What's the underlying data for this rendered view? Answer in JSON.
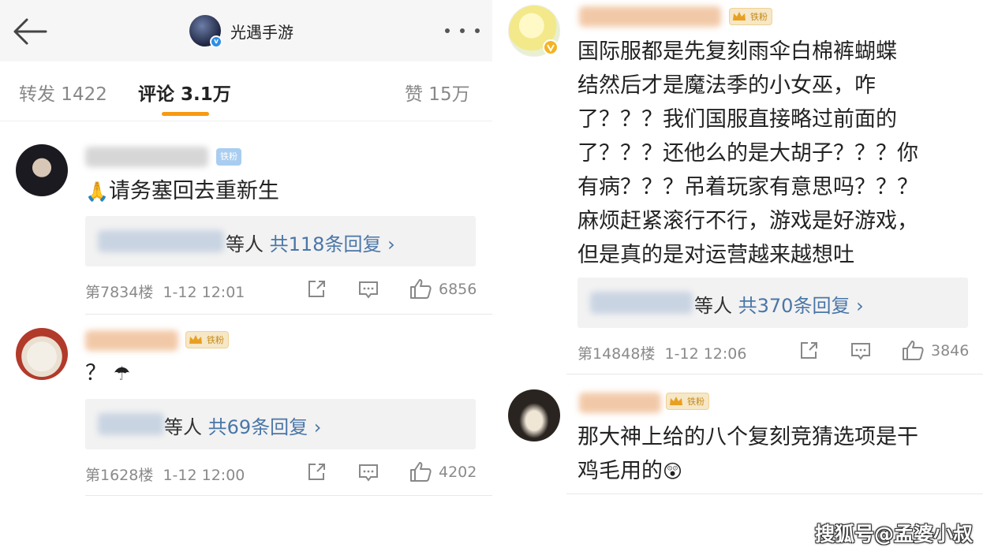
{
  "header": {
    "account_name": "光遇手游",
    "back_icon": "arrow-left-icon",
    "more_icon": "more-dots-icon",
    "verified_color": "#2e8ee8"
  },
  "tabs": {
    "repost": "转发 1422",
    "comments": "评论 3.1万",
    "likes": "赞 15万",
    "accent": "#f79a11"
  },
  "comments": [
    {
      "badge": "铁粉",
      "emoji": "pray-hands-icon",
      "text": "请务塞回去重新生",
      "reply_suffix": "等人",
      "reply_count": "共118条回复 ›",
      "floor": "第7834楼",
      "time": "1-12 12:01",
      "likes": "6856"
    },
    {
      "badge": "铁粉",
      "text": "？",
      "emoji": "umbrella-icon",
      "reply_suffix": "等人",
      "reply_count": "共69条回复 ›",
      "floor": "第1628楼",
      "time": "1-12 12:00",
      "likes": "4202"
    },
    {
      "badge": "铁粉",
      "lines": [
        "国际服都是先复刻雨伞白棉裤蝴蝶",
        "结然后才是魔法季的小女巫，咋",
        "了？？？我们国服直接略过前面的",
        "了？？？还他么的是大胡子？？？你",
        "有病？？？吊着玩家有意思吗？？？",
        "麻烦赶紧滚行不行，游戏是好游戏，",
        "但是真的是对运营越来越想吐"
      ],
      "reply_suffix": "等人",
      "reply_count": "共370条回复 ›",
      "floor": "第14848楼",
      "time": "1-12 12:06",
      "likes": "3846"
    },
    {
      "badge": "铁粉",
      "lines": [
        "那大神上给的八个复刻竞猜选项是干",
        "鸡毛用的"
      ],
      "emoji": "shocked-face-icon"
    }
  ],
  "watermark": "搜狐号@孟婆小叔"
}
